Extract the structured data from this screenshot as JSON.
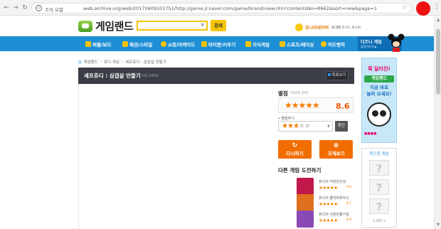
{
  "browser": {
    "insecure_label": "주의 요함",
    "url": "web.archive.org/web/20170609101751/http://game.jr.naver.com/game/brand/view.nhn?contentsNo=8662&sort=new&page=1",
    "back_icon": "arrow-left-icon",
    "forward_icon": "arrow-right-icon",
    "reload_icon": "reload-icon"
  },
  "header": {
    "logo_text": "게임랜드",
    "search_button": "검색",
    "jr_promo": "쥬니어네이버",
    "jr_promo_sub": "36개월 친구는 쥬니버"
  },
  "nav": {
    "items": [
      {
        "label": "퍼즐/보드",
        "color": "#f6c400"
      },
      {
        "label": "패션/스타일",
        "color": "#f6c400"
      },
      {
        "label": "쇼핑/아케이드",
        "color": "#f6c400"
      },
      {
        "label": "타이쿤/키우기",
        "color": "#f6c400"
      },
      {
        "label": "지식게임",
        "color": "#f6c400"
      },
      {
        "label": "스포츠/레이싱",
        "color": "#f6c400"
      },
      {
        "label": "어드벤처",
        "color": "#f6c400"
      }
    ],
    "disney_label": "디즈니 게임",
    "disney_sub": "플레이하기 ▶"
  },
  "breadcrumb": [
    "게임랜드",
    "쥬디 게임",
    "셰프쥬디 : 삼겹살 만들기"
  ],
  "game": {
    "title": "셰프쥬디 : 삼겹살 만들기",
    "plays": "조회 248회",
    "list_button": "목록보기"
  },
  "rating": {
    "title": "별점",
    "count": "(580명 참여)",
    "stars": "★★★★★",
    "score": "8.6",
    "my_label": "• 별점주기",
    "my_stars": "★★★★★",
    "confirm": "확인"
  },
  "actions": {
    "restart_icon": "↻",
    "restart": "다시하기",
    "fullscreen_icon": "⊕",
    "fullscreen": "크게보기"
  },
  "other_games": {
    "title": "다른 게임 도전하기",
    "items": [
      {
        "name": "쥬디의 커피만드닷",
        "stars": "★★★★★",
        "score": "9.0",
        "color": "#c2184a"
      },
      {
        "name": "쥬디의 졸라피하우스",
        "stars": "★★★★★",
        "score": "8.7",
        "color": "#e07020"
      },
      {
        "name": "쥬디의 사원만들기당",
        "stars": "★★★★★",
        "score": "8.9",
        "color": "#8a4ab5"
      }
    ]
  },
  "ad": {
    "line1": "확 달라진!",
    "logo": "게임랜드",
    "line2": "지금 바로\n놀러 오세요!",
    "dots": "●●●●"
  },
  "recent": {
    "title": "최근한 게임",
    "boxes": [
      "?",
      "?",
      "?"
    ],
    "pager": "< 0/0 >"
  }
}
